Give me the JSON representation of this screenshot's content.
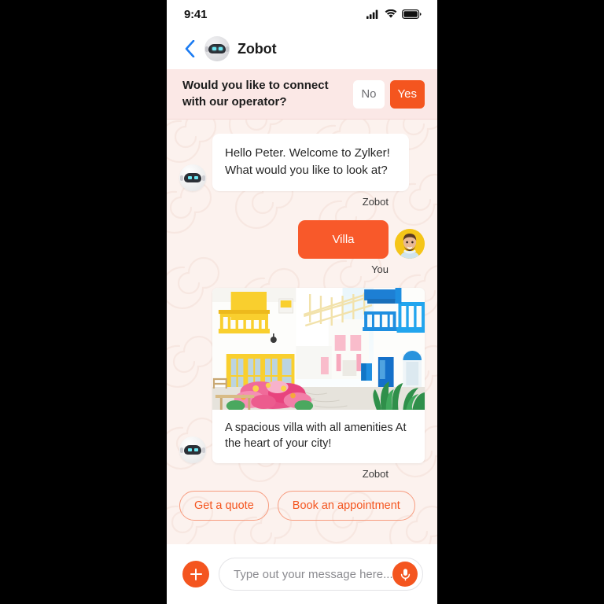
{
  "status_bar": {
    "time": "9:41",
    "icons": [
      "cellular-signal-icon",
      "wifi-icon",
      "battery-icon"
    ]
  },
  "header": {
    "back_icon": "chevron-left-icon",
    "avatar_icon": "robot-avatar-icon",
    "title": "Zobot"
  },
  "operator_banner": {
    "prompt": "Would you like to connect with our operator?",
    "no_label": "No",
    "yes_label": "Yes",
    "background_color": "#fbe8e6",
    "yes_color": "#f4551f"
  },
  "conversation": [
    {
      "type": "text",
      "sender": "bot",
      "avatar_icon": "robot-avatar-icon",
      "text": "Hello Peter. Welcome to Zylker! What would you like to look at?",
      "sender_label": "Zobot"
    },
    {
      "type": "text",
      "sender": "user",
      "avatar_icon": "user-photo-avatar",
      "text": "Villa",
      "sender_label": "You"
    },
    {
      "type": "card",
      "sender": "bot",
      "avatar_icon": "robot-avatar-icon",
      "image_alt": "mediterranean-villa-street-photo",
      "caption": "A spacious villa with all amenities At the heart of your city!",
      "sender_label": "Zobot"
    }
  ],
  "quick_replies": [
    {
      "label": "Get a quote"
    },
    {
      "label": "Book an appointment"
    }
  ],
  "composer": {
    "add_icon": "plus-icon",
    "placeholder": "Type out your message here...",
    "value": "",
    "mic_icon": "microphone-icon",
    "accent_color": "#f4551f"
  },
  "theme": {
    "chat_background": "#fcf2ee",
    "user_bubble": "#f8592a",
    "chip_border": "#f79c7f"
  }
}
